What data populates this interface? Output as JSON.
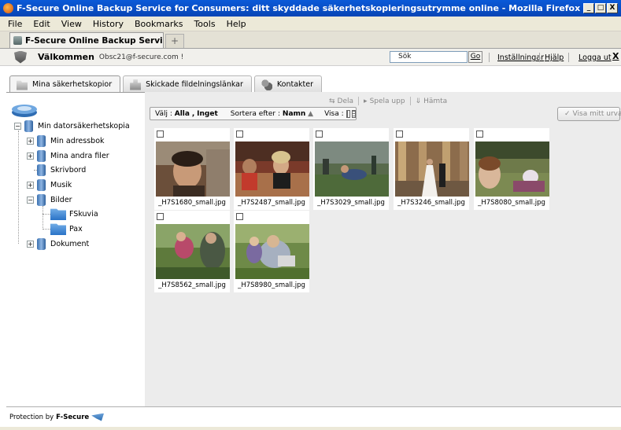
{
  "window": {
    "title": "F-Secure Online Backup Service for Consumers: ditt skyddade säkerhetskopieringsutrymme online - Mozilla Firefox",
    "min": "_",
    "max": "□",
    "close": "X"
  },
  "menubar": {
    "items": [
      "File",
      "Edit",
      "View",
      "History",
      "Bookmarks",
      "Tools",
      "Help"
    ]
  },
  "browser_tab": {
    "label": "F-Secure Online Backup Service for C...",
    "new_tab": "+"
  },
  "header": {
    "welcome": "Välkommen",
    "email": "Obsc21@f-secure.com !",
    "search_value": "Sök",
    "go": "Go",
    "settings": "Inställningar",
    "help": "Hjälp",
    "logout": "Logga ut",
    "close": "X"
  },
  "app_tabs": [
    {
      "label": "Mina säkerhetskopior",
      "active": true
    },
    {
      "label": "Skickade fildelningslänkar",
      "active": false
    },
    {
      "label": "Kontakter",
      "active": false
    }
  ],
  "tree": {
    "root": "Min datorsäkerhetskopia",
    "items": [
      "Min adressbok",
      "Mina andra filer",
      "Skrivbord",
      "Musik",
      "Bilder",
      "Dokument"
    ],
    "bilder_children": [
      "FSkuvia",
      "Pax"
    ]
  },
  "actions": {
    "share": "Dela",
    "play": "Spela upp",
    "download": "Hämta"
  },
  "filter": {
    "select_label": "Välj :",
    "select_all": "Alla",
    "select_sep": ",",
    "select_none": "Inget",
    "sort_label": "Sortera efter :",
    "sort_value": "Namn",
    "sort_arrow": "▲",
    "view_label": "Visa :"
  },
  "show_selection": "Visa mitt urval",
  "photos": [
    {
      "name": "_H7S1680_small.jpg"
    },
    {
      "name": "_H7S2487_small.jpg"
    },
    {
      "name": "_H7S3029_small.jpg"
    },
    {
      "name": "_H7S3246_small.jpg"
    },
    {
      "name": "_H7S8080_small.jpg"
    },
    {
      "name": "_H7S8562_small.jpg"
    },
    {
      "name": "_H7S8980_small.jpg"
    }
  ],
  "footer": {
    "protection": "Protection by",
    "brand": "F-Secure"
  }
}
